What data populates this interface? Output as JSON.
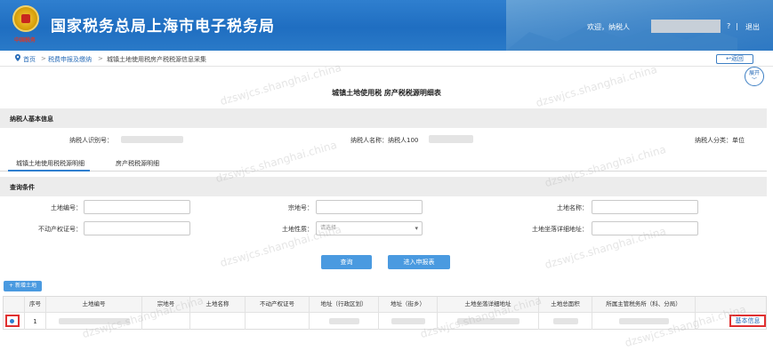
{
  "header": {
    "logo_sub": "中国税务",
    "title": "国家税务总局上海市电子税务局",
    "welcome": "欢迎，纳税人",
    "user_mark": "?",
    "separator": "|",
    "logout": "退出"
  },
  "breadcrumb": {
    "home": "首页",
    "arrow": ">",
    "mid": "税费申报及缴纳",
    "current": "城镇土地使用税房产税税源信息采集"
  },
  "back_label": "返回",
  "expand_label": "展开",
  "page_title": "城镇土地使用税 房产税税源明细表",
  "taxpayer_section": {
    "title": "纳税人基本信息",
    "id_label": "纳税人识别号：",
    "name_label": "纳税人名称：纳税人100",
    "type_label": "纳税人分类：单位"
  },
  "tabs": [
    "城镇土地使用税税源明细",
    "房产税税源明细"
  ],
  "query_section": {
    "title": "查询条件",
    "fields": {
      "land_no": "土地编号：",
      "parcel_no": "宗地号：",
      "land_name": "土地名称：",
      "property_cert": "不动产权证号：",
      "land_nature": "土地性质：",
      "land_address": "土地坐落详细地址："
    },
    "land_nature_placeholder": "请选择"
  },
  "buttons": {
    "query": "查询",
    "enter_report": "进入申报表",
    "add_land": "+ 新增土地",
    "basic_info": "基本信息"
  },
  "table": {
    "headers": [
      "",
      "序号",
      "土地编号",
      "宗地号",
      "土地名称",
      "不动产权证号",
      "地址（行政区划）",
      "地址（街乡）",
      "土地坐落详细地址",
      "土地总面积",
      "所属主管税务所（科、分局）",
      ""
    ],
    "rows": [
      {
        "index": "1"
      }
    ]
  },
  "watermark": "dzswjcs.shanghai.china",
  "colors": {
    "header_blue": "#1f6ec1",
    "link_blue": "#2a6db8",
    "button_blue": "#4a9ae0",
    "highlight_red": "#e03030"
  }
}
